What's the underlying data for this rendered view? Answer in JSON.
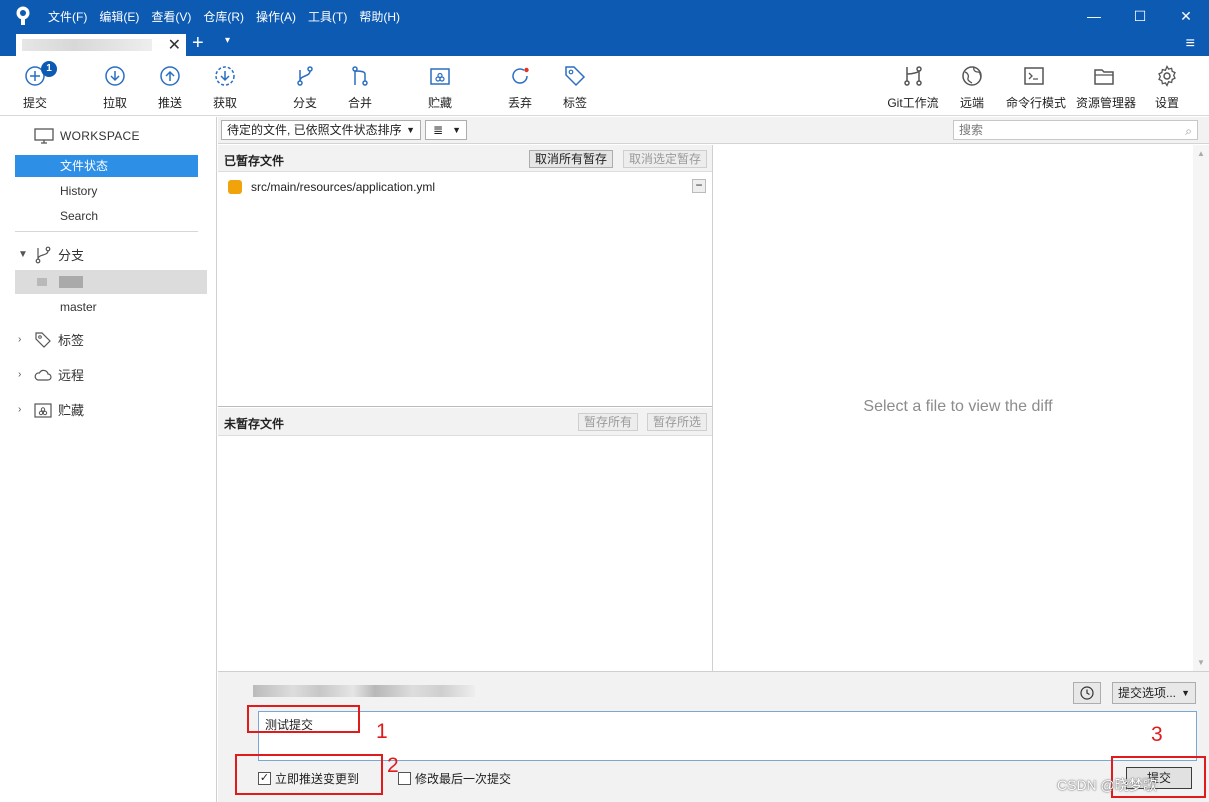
{
  "titlebar": {
    "menu": [
      "文件(F)",
      "编辑(E)",
      "查看(V)",
      "仓库(R)",
      "操作(A)",
      "工具(T)",
      "帮助(H)"
    ],
    "controls": {
      "minimize": "—",
      "maximize": "☐",
      "close": "✕"
    }
  },
  "tabbar": {
    "close": "✕",
    "add": "+",
    "dropdown": "▾",
    "menu": "≡"
  },
  "toolbar": {
    "commit": {
      "label": "提交",
      "badge": "1"
    },
    "pull": "拉取",
    "push": "推送",
    "fetch": "获取",
    "branch": "分支",
    "merge": "合并",
    "stash": "贮藏",
    "discard": "丢弃",
    "tag": "标签",
    "gitflow": "Git工作流",
    "remote": "远端",
    "terminal": "命令行模式",
    "explorer": "资源管理器",
    "settings": "设置"
  },
  "sidebar": {
    "workspace": "WORKSPACE",
    "file_status": "文件状态",
    "history": "History",
    "search": "Search",
    "branches": "分支",
    "master": "master",
    "tags": "标签",
    "remotes": "远程",
    "stashes": "贮藏"
  },
  "filterbar": {
    "sort": "待定的文件, 已依照文件状态排序",
    "view": "≣",
    "search_placeholder": "搜索"
  },
  "staged": {
    "title": "已暂存文件",
    "unstage_all": "取消所有暂存",
    "unstage_selected": "取消选定暂存",
    "files": [
      "src/main/resources/application.yml"
    ]
  },
  "unstaged": {
    "title": "未暂存文件",
    "stage_all": "暂存所有",
    "stage_selected": "暂存所选"
  },
  "diff": {
    "empty_message": "Select a file to view the diff"
  },
  "commit": {
    "message": "测试提交",
    "options": "提交选项...",
    "push_now": "立即推送变更到",
    "amend": "修改最后一次提交",
    "submit": "提交"
  },
  "annotations": [
    "1",
    "2",
    "3"
  ],
  "watermark": "CSDN @晓梦歌",
  "colors": {
    "titlebar": "#0d5ab3",
    "selection": "#2d8fe6",
    "annotation": "#e01b1b",
    "file_modified": "#f0a30a"
  }
}
